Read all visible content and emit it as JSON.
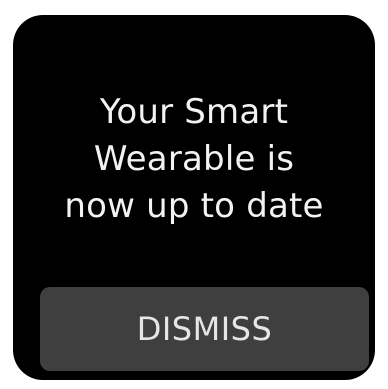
{
  "notification": {
    "line1": "Your Smart",
    "line2": "Wearable is",
    "line3": "now up to date"
  },
  "actions": {
    "dismiss_label": "DISMISS"
  },
  "colors": {
    "screen_background": "#000000",
    "button_background": "#3f3f3f",
    "text": "#f2f2f2"
  }
}
